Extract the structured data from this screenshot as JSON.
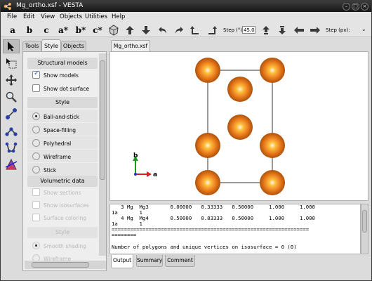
{
  "window": {
    "title": "Mg_ortho.xsf - VESTA"
  },
  "menu": [
    "File",
    "Edit",
    "View",
    "Objects",
    "Utilities",
    "Help"
  ],
  "toolbar": {
    "letters": [
      "a",
      "b",
      "c",
      "a*",
      "b*",
      "c*"
    ],
    "step_label": "Step (°):",
    "step_value": "45.0",
    "steppx_label": "Step (px):"
  },
  "left_tools": [
    "select-arrow-icon",
    "select-region-icon",
    "translate-icon",
    "magnifier-icon",
    "distance-icon",
    "angle-icon",
    "dihedral-icon",
    "boundary-icon"
  ],
  "panel": {
    "tabs": [
      "Tools",
      "Style",
      "Objects"
    ],
    "active_tab": "Style",
    "structural_title": "Structural models",
    "show_models": "Show models",
    "show_dot_surface": "Show dot surface",
    "style_title": "Style",
    "styles": [
      "Ball-and-stick",
      "Space-filling",
      "Polyhedral",
      "Wireframe",
      "Stick"
    ],
    "selected_style": "Ball-and-stick",
    "volumetric_title": "Volumetric data",
    "vol_options": [
      "Show sections",
      "Show isosurfaces",
      "Surface coloring"
    ],
    "vol_style_title": "Style",
    "vol_styles": [
      "Smooth shading",
      "Wireframe"
    ]
  },
  "file_tab": "Mg_ortho.xsf",
  "axes": {
    "b": "b",
    "a": "a"
  },
  "output_lines": [
    "   3 Mg  Mg3       0.00000   0.33333   0.50000     1.000     1.000",
    "1a       1",
    "   4 Mg  Mg4       0.50000   0.83333   0.50000     1.000     1.000",
    "1a       1",
    "================================================================",
    "========",
    "",
    "Number of polygons and unique vertices on isosurface = 0 (0)"
  ],
  "output_tabs": [
    "Output",
    "Summary",
    "Comment"
  ],
  "colors": {
    "atom": "#e8791a",
    "title_bar": "#1f1f1f",
    "axis_a": "#d42020",
    "axis_b": "#1a9a1a"
  }
}
